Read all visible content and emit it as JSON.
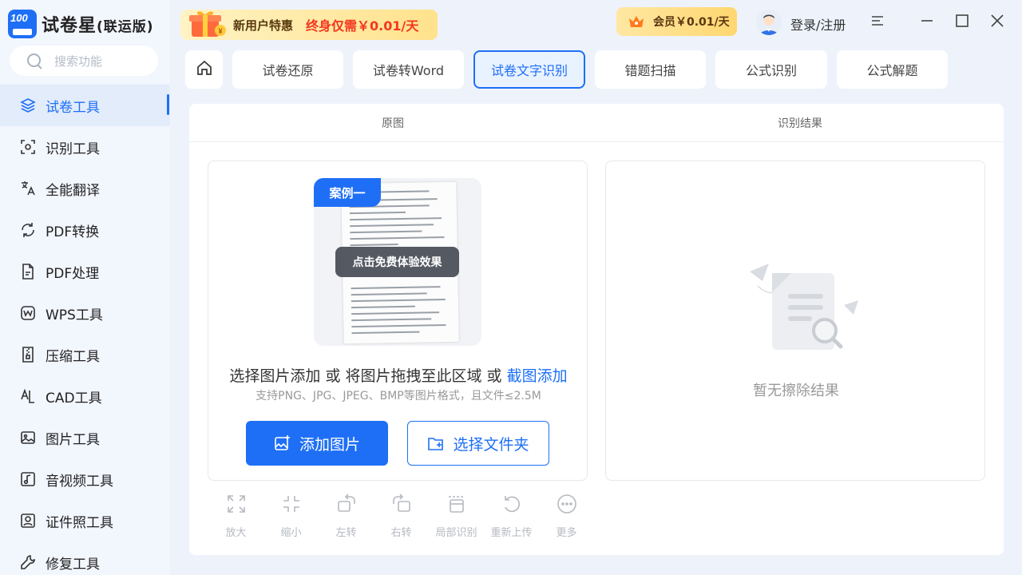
{
  "app": {
    "logo_badge": "100",
    "name": "试卷星",
    "edition": "(联运版)"
  },
  "search": {
    "placeholder": "搜索功能"
  },
  "sidebar": {
    "items": [
      {
        "label": "试卷工具",
        "icon": "layers-icon",
        "active": true
      },
      {
        "label": "识别工具",
        "icon": "scan-icon",
        "active": false
      },
      {
        "label": "全能翻译",
        "icon": "translate-icon",
        "active": false
      },
      {
        "label": "PDF转换",
        "icon": "convert-icon",
        "active": false
      },
      {
        "label": "PDF处理",
        "icon": "pdf-file-icon",
        "active": false
      },
      {
        "label": "WPS工具",
        "icon": "wps-icon",
        "active": false
      },
      {
        "label": "压缩工具",
        "icon": "zip-icon",
        "active": false
      },
      {
        "label": "CAD工具",
        "icon": "cad-icon",
        "active": false
      },
      {
        "label": "图片工具",
        "icon": "image-icon",
        "active": false
      },
      {
        "label": "音视频工具",
        "icon": "music-icon",
        "active": false
      },
      {
        "label": "证件照工具",
        "icon": "id-photo-icon",
        "active": false
      },
      {
        "label": "修复工具",
        "icon": "repair-icon",
        "active": false
      }
    ]
  },
  "header": {
    "promo_label": "新用户特惠",
    "promo_price": "终身仅需￥0.01/天",
    "vip_label": "会员￥0.01/天",
    "login_label": "登录/注册"
  },
  "tabs": [
    {
      "label": "试卷还原",
      "active": false
    },
    {
      "label": "试卷转Word",
      "active": false
    },
    {
      "label": "试卷文字识别",
      "active": true
    },
    {
      "label": "错题扫描",
      "active": false
    },
    {
      "label": "公式识别",
      "active": false
    },
    {
      "label": "公式解题",
      "active": false
    }
  ],
  "main": {
    "source_header": "原图",
    "result_header": "识别结果",
    "sample_tag": "案例一",
    "sample_cta": "点击免费体验效果",
    "hint_prefix": "选择图片添加 或 将图片拖拽至此区域 或 ",
    "hint_link": "截图添加",
    "formats": "支持PNG、JPG、JPEG、BMP等图片格式，且文件≤2.5M",
    "add_image_label": "添加图片",
    "choose_folder_label": "选择文件夹",
    "empty_result": "暂无擦除结果"
  },
  "tools": [
    {
      "label": "放大",
      "icon": "zoom-in-icon"
    },
    {
      "label": "缩小",
      "icon": "zoom-out-icon"
    },
    {
      "label": "左转",
      "icon": "rotate-left-icon"
    },
    {
      "label": "右转",
      "icon": "rotate-right-icon"
    },
    {
      "label": "局部识别",
      "icon": "crop-icon"
    },
    {
      "label": "重新上传",
      "icon": "reupload-icon"
    },
    {
      "label": "更多",
      "icon": "more-icon"
    }
  ],
  "colors": {
    "accent": "#1e6ff6",
    "promo_price": "#f4361f",
    "sidebar_bg": "#f2f6fd",
    "page_bg": "#eef3fb"
  }
}
